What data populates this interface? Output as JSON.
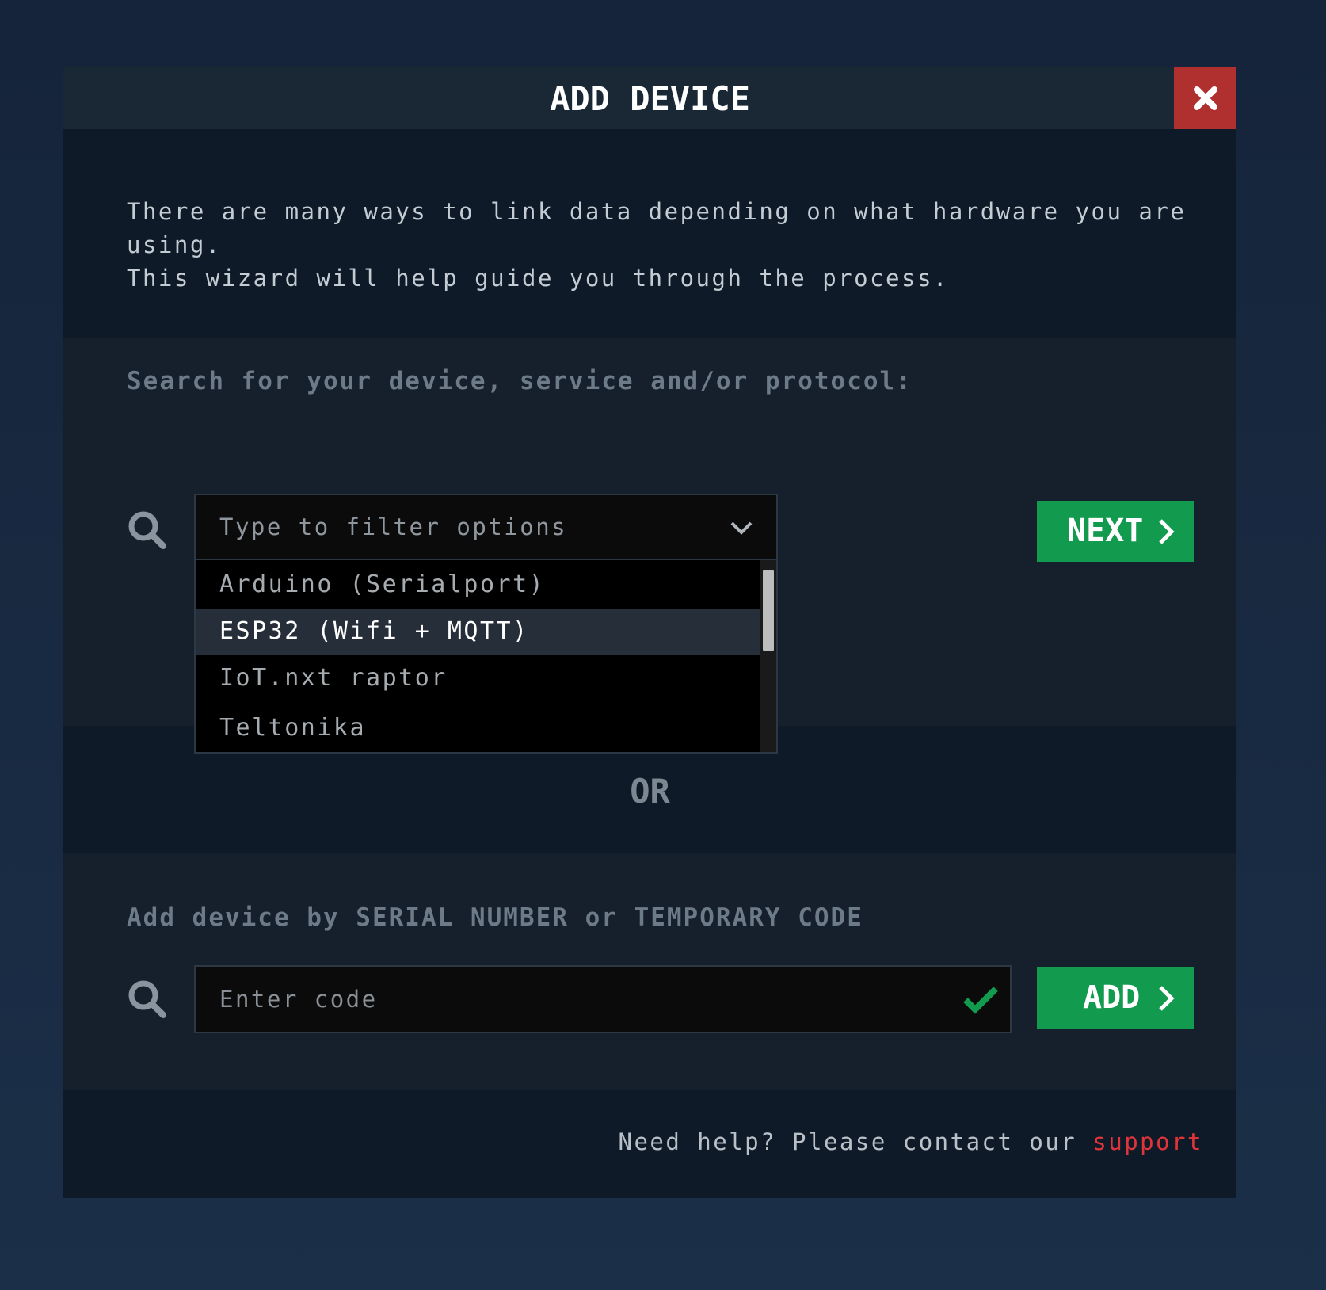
{
  "dialog": {
    "title": "ADD DEVICE",
    "close_icon": "close-x-icon"
  },
  "intro": {
    "line1": "There are many ways to link data depending on what hardware you are using.",
    "line2": "This wizard will help guide you through the process."
  },
  "search_section": {
    "label": "Search for your device, service and/or protocol:",
    "select_placeholder": "Type to filter options",
    "options": [
      {
        "label": "Arduino (Serialport)",
        "active": false
      },
      {
        "label": "ESP32 (Wifi + MQTT)",
        "active": true
      },
      {
        "label": "IoT.nxt raptor",
        "active": false
      },
      {
        "label": "Teltonika",
        "active": false
      }
    ],
    "next_button": "NEXT",
    "icons": [
      "search-icon",
      "chevron-down-icon",
      "chevron-right-icon"
    ]
  },
  "separator": "OR",
  "code_section": {
    "label": "Add device by SERIAL NUMBER or TEMPORARY CODE",
    "input_placeholder": "Enter code",
    "input_value": "",
    "add_button": "ADD",
    "icons": [
      "search-icon",
      "check-icon",
      "chevron-right-icon"
    ]
  },
  "footer": {
    "help_text": "Need help? Please contact our ",
    "support_link": "support"
  },
  "colors": {
    "accent_green": "#129a4f",
    "close_red": "#b02f2f",
    "link_red": "#e0343b",
    "background": "#1b2f48",
    "dialog_bg": "#0e1a27"
  }
}
